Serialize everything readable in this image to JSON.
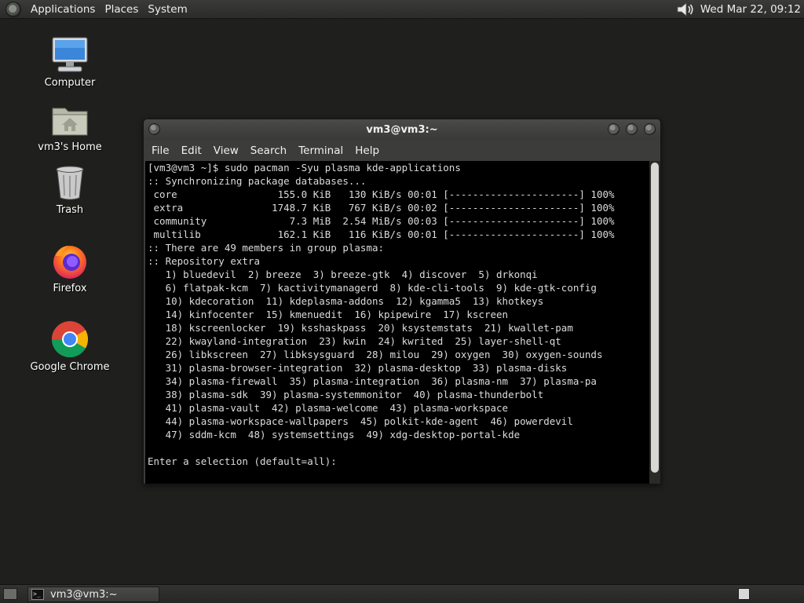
{
  "top_panel": {
    "menus": [
      "Applications",
      "Places",
      "System"
    ],
    "clock": "Wed Mar 22, 09:12"
  },
  "desktop": {
    "icons": [
      {
        "label": "Computer",
        "icon": "computer-icon"
      },
      {
        "label": "vm3's Home",
        "icon": "home-folder-icon"
      },
      {
        "label": "Trash",
        "icon": "trash-icon"
      },
      {
        "label": "Firefox",
        "icon": "firefox-icon"
      },
      {
        "label": "Google Chrome",
        "icon": "chrome-icon"
      }
    ]
  },
  "terminal": {
    "title": "vm3@vm3:~",
    "menu": [
      "File",
      "Edit",
      "View",
      "Search",
      "Terminal",
      "Help"
    ],
    "lines": [
      "[vm3@vm3 ~]$ sudo pacman -Syu plasma kde-applications",
      ":: Synchronizing package databases...",
      " core                 155.0 KiB   130 KiB/s 00:01 [----------------------] 100%",
      " extra               1748.7 KiB   767 KiB/s 00:02 [----------------------] 100%",
      " community              7.3 MiB  2.54 MiB/s 00:03 [----------------------] 100%",
      " multilib             162.1 KiB   116 KiB/s 00:01 [----------------------] 100%",
      ":: There are 49 members in group plasma:",
      ":: Repository extra",
      "   1) bluedevil  2) breeze  3) breeze-gtk  4) discover  5) drkonqi",
      "   6) flatpak-kcm  7) kactivitymanagerd  8) kde-cli-tools  9) kde-gtk-config",
      "   10) kdecoration  11) kdeplasma-addons  12) kgamma5  13) khotkeys",
      "   14) kinfocenter  15) kmenuedit  16) kpipewire  17) kscreen",
      "   18) kscreenlocker  19) ksshaskpass  20) ksystemstats  21) kwallet-pam",
      "   22) kwayland-integration  23) kwin  24) kwrited  25) layer-shell-qt",
      "   26) libkscreen  27) libksysguard  28) milou  29) oxygen  30) oxygen-sounds",
      "   31) plasma-browser-integration  32) plasma-desktop  33) plasma-disks",
      "   34) plasma-firewall  35) plasma-integration  36) plasma-nm  37) plasma-pa",
      "   38) plasma-sdk  39) plasma-systemmonitor  40) plasma-thunderbolt",
      "   41) plasma-vault  42) plasma-welcome  43) plasma-workspace",
      "   44) plasma-workspace-wallpapers  45) polkit-kde-agent  46) powerdevil",
      "   47) sddm-kcm  48) systemsettings  49) xdg-desktop-portal-kde",
      "",
      "Enter a selection (default=all):"
    ]
  },
  "taskbar": {
    "task_label": "vm3@vm3:~"
  }
}
